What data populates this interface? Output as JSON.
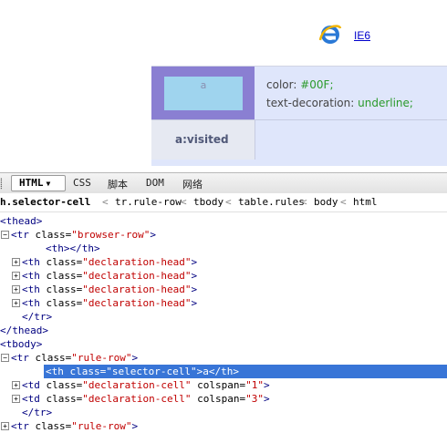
{
  "page": {
    "ie_link_text": "IE6",
    "selector_a": "a",
    "declaration": {
      "prop1": "color:",
      "val1": "#00F;",
      "prop2": "text-decoration:",
      "val2": "underline;"
    },
    "visited_label": "a:visited"
  },
  "toolbar": {
    "html_tab": "HTML",
    "css_tab": "CSS",
    "script_tab": "脚本",
    "dom_tab": "DOM",
    "net_tab": "网络"
  },
  "breadcrumb": [
    "h.selector-cell",
    "tr.rule-row",
    "tbody",
    "table.rules",
    "body",
    "html"
  ],
  "tree": [
    {
      "text": "<thead>",
      "indent": 0,
      "twisty": ""
    },
    {
      "text": "<tr class=\"browser-row\">",
      "indent": 1,
      "twisty": "-"
    },
    {
      "text": "<th></th>",
      "indent": 3,
      "twisty": ""
    },
    {
      "text": "<th class=\"declaration-head\">",
      "indent": 2,
      "twisty": "+"
    },
    {
      "text": "<th class=\"declaration-head\">",
      "indent": 2,
      "twisty": "+"
    },
    {
      "text": "<th class=\"declaration-head\">",
      "indent": 2,
      "twisty": "+"
    },
    {
      "text": "<th class=\"declaration-head\">",
      "indent": 2,
      "twisty": "+"
    },
    {
      "text": "</tr>",
      "indent": 2,
      "twisty": ""
    },
    {
      "text": "</thead>",
      "indent": 0,
      "twisty": ""
    },
    {
      "text": "<tbody>",
      "indent": 0,
      "twisty": ""
    },
    {
      "text": "<tr class=\"rule-row\">",
      "indent": 1,
      "twisty": "-"
    },
    {
      "text": "<th class=\"selector-cell\">a</th>",
      "indent": 3,
      "twisty": "",
      "selected": true
    },
    {
      "text": "<td class=\"declaration-cell\" colspan=\"1\">",
      "indent": 2,
      "twisty": "+"
    },
    {
      "text": "<td class=\"declaration-cell\" colspan=\"3\">",
      "indent": 2,
      "twisty": "+"
    },
    {
      "text": "</tr>",
      "indent": 2,
      "twisty": ""
    },
    {
      "text": "<tr class=\"rule-row\">",
      "indent": 1,
      "twisty": "+"
    }
  ]
}
